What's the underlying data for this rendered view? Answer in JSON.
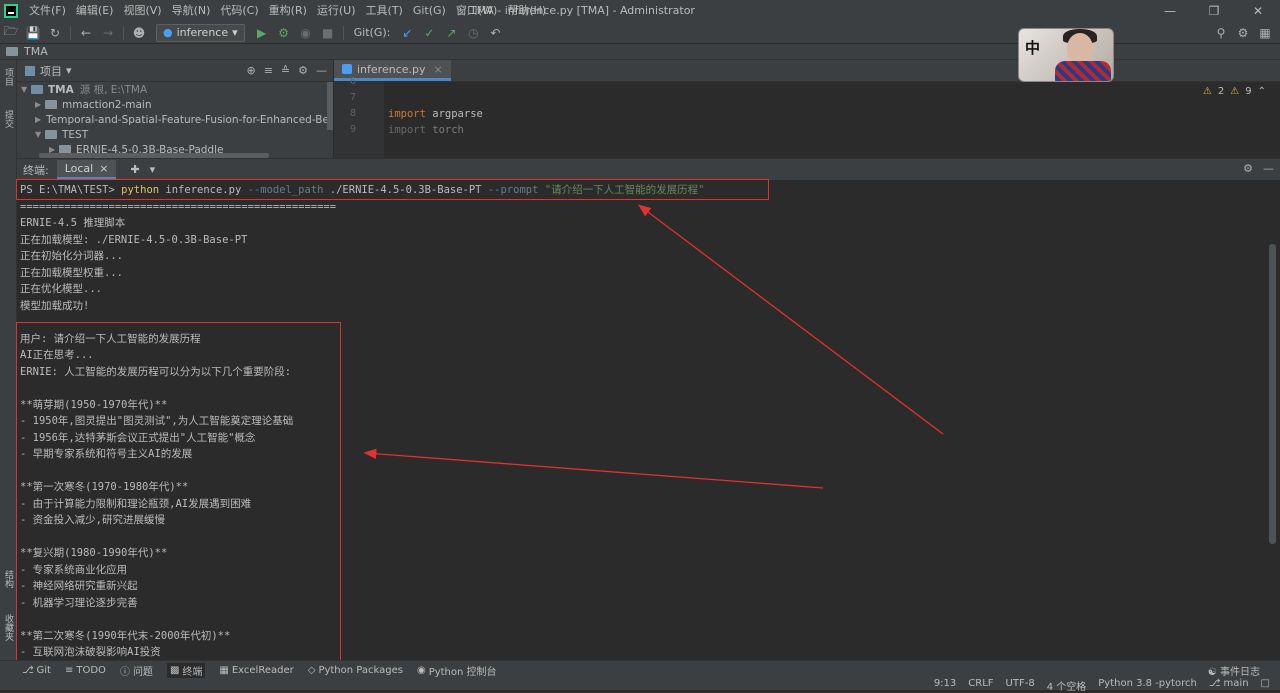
{
  "menu": {
    "items": [
      "文件(F)",
      "编辑(E)",
      "视图(V)",
      "导航(N)",
      "代码(C)",
      "重构(R)",
      "运行(U)",
      "工具(T)",
      "Git(G)",
      "窗口(W)",
      "帮助(H)"
    ],
    "window_title": "TMA - inference.py [TMA] - Administrator"
  },
  "toolbar": {
    "run_config": "inference",
    "git_label": "Git(G):"
  },
  "navbar": {
    "project": "TMA"
  },
  "side_tabs": {
    "project": "项目",
    "commit": "提交",
    "structure": "结构",
    "favorites": "收藏夹"
  },
  "project_panel": {
    "title": "项目",
    "tree": [
      {
        "name": "TMA",
        "extra": "源 根, E:\\TMA",
        "level": 0
      },
      {
        "name": "mmaction2-main",
        "extra": "",
        "level": 1
      },
      {
        "name": "Temporal-and-Spatial-Feature-Fusion-for-Enhanced-Behavior-",
        "extra": "",
        "level": 1
      },
      {
        "name": "TEST",
        "extra": "",
        "level": 1
      },
      {
        "name": "ERNIE-4.5-0.3B-Base-Paddle",
        "extra": "",
        "level": 2
      }
    ]
  },
  "editor": {
    "tab": "inference.py",
    "lines": [
      {
        "no": "6",
        "kw": "",
        "rest": ""
      },
      {
        "no": "7",
        "kw": "",
        "rest": ""
      },
      {
        "no": "8",
        "kw": "import",
        "rest": " argparse"
      },
      {
        "no": "9",
        "kw": "import",
        "rest": " torch"
      }
    ],
    "warnings": "2",
    "weak_warnings": "9"
  },
  "avatar": {
    "badge": "中"
  },
  "terminal": {
    "header_label": "终端:",
    "tab": "Local",
    "command": {
      "prompt": "PS E:\\TMA\\TEST> ",
      "exe": "python",
      "script": " inference.py ",
      "flag1": "--model_path",
      "val1": " ./ERNIE-4.5-0.3B-Base-PT ",
      "flag2": "--prompt",
      "val2": " \"请介绍一下人工智能的发展历程\""
    },
    "lines": [
      "==================================================",
      "ERNIE-4.5 推理脚本",
      "正在加载模型: ./ERNIE-4.5-0.3B-Base-PT",
      "正在初始化分词器...",
      "正在加载模型权重...",
      "正在优化模型...",
      "模型加载成功!",
      "",
      "用户: 请介绍一下人工智能的发展历程",
      "AI正在思考...",
      "ERNIE: 人工智能的发展历程可以分为以下几个重要阶段:",
      "",
      "**萌芽期(1950-1970年代)**",
      "- 1950年,图灵提出\"图灵测试\",为人工智能奠定理论基础",
      "- 1956年,达特茅斯会议正式提出\"人工智能\"概念",
      "- 早期专家系统和符号主义AI的发展",
      "",
      "**第一次寒冬(1970-1980年代)**",
      "- 由于计算能力限制和理论瓶颈,AI发展遇到困难",
      "- 资金投入减少,研究进展缓慢",
      "",
      "**复兴期(1980-1990年代)**",
      "- 专家系统商业化应用",
      "- 神经网络研究重新兴起",
      "- 机器学习理论逐步完善",
      "",
      "**第二次寒冬(1990年代末-2000年代初)**",
      "- 互联网泡沫破裂影响AI投资"
    ]
  },
  "statusbar": {
    "tools": [
      "Git",
      "TODO",
      "问题",
      "终端",
      "ExcelReader",
      "Python Packages",
      "Python 控制台"
    ],
    "event_log": "事件日志",
    "position": "9:13",
    "line_sep": "CRLF",
    "encoding": "UTF-8",
    "indent": "4 个空格",
    "interpreter": "Python 3.8 -pytorch",
    "branch": "main"
  },
  "colors": {
    "annotation": "#e0322e",
    "accent": "#4a88c7"
  }
}
